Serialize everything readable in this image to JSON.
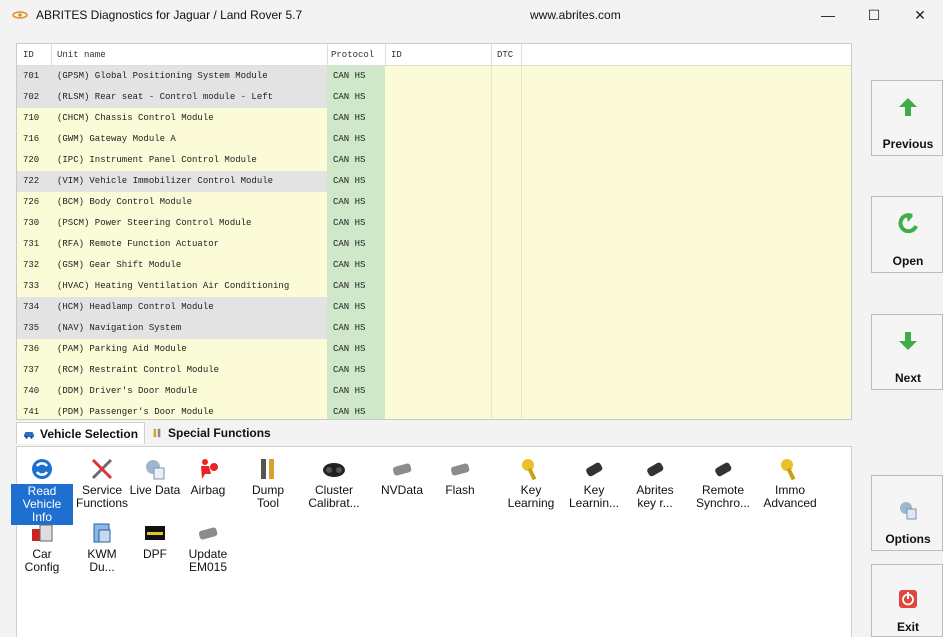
{
  "window": {
    "title": "ABRITES Diagnostics for Jaguar / Land Rover 5.7",
    "url": "www.abrites.com",
    "min_glyph": "—",
    "max_glyph": "☐",
    "close_glyph": "✕"
  },
  "table": {
    "headers": {
      "id": "ID",
      "unit_name": "Unit name",
      "protocol": "Protocol",
      "id2": "ID",
      "dtc": "DTC"
    },
    "rows": [
      {
        "id": "701",
        "name": "(GPSM) Global Positioning System Module",
        "protocol": "CAN HS",
        "shade": "grey"
      },
      {
        "id": "702",
        "name": "(RLSM) Rear seat  -  Control module  -  Left",
        "protocol": "CAN HS",
        "shade": "grey"
      },
      {
        "id": "710",
        "name": "(CHCM) Chassis Control Module",
        "protocol": "CAN HS",
        "shade": "yellow"
      },
      {
        "id": "716",
        "name": "(GWM) Gateway Module A",
        "protocol": "CAN HS",
        "shade": "yellow"
      },
      {
        "id": "720",
        "name": "(IPC) Instrument Panel Control Module",
        "protocol": "CAN HS",
        "shade": "yellow"
      },
      {
        "id": "722",
        "name": "(VIM) Vehicle Immobilizer Control Module",
        "protocol": "CAN HS",
        "shade": "grey"
      },
      {
        "id": "726",
        "name": "(BCM) Body Control Module",
        "protocol": "CAN HS",
        "shade": "yellow"
      },
      {
        "id": "730",
        "name": "(PSCM) Power Steering Control Module",
        "protocol": "CAN HS",
        "shade": "yellow"
      },
      {
        "id": "731",
        "name": "(RFA) Remote Function Actuator",
        "protocol": "CAN HS",
        "shade": "yellow"
      },
      {
        "id": "732",
        "name": "(GSM) Gear Shift Module",
        "protocol": "CAN HS",
        "shade": "yellow"
      },
      {
        "id": "733",
        "name": "(HVAC) Heating Ventilation Air Conditioning",
        "protocol": "CAN HS",
        "shade": "yellow"
      },
      {
        "id": "734",
        "name": "(HCM) Headlamp Control Module",
        "protocol": "CAN HS",
        "shade": "grey"
      },
      {
        "id": "735",
        "name": "(NAV) Navigation System",
        "protocol": "CAN HS",
        "shade": "grey"
      },
      {
        "id": "736",
        "name": "(PAM) Parking Aid Module",
        "protocol": "CAN HS",
        "shade": "yellow"
      },
      {
        "id": "737",
        "name": "(RCM) Restraint Control Module",
        "protocol": "CAN HS",
        "shade": "yellow"
      },
      {
        "id": "740",
        "name": "(DDM) Driver's Door Module",
        "protocol": "CAN HS",
        "shade": "yellow"
      },
      {
        "id": "741",
        "name": "(PDM) Passenger's Door Module",
        "protocol": "CAN HS",
        "shade": "yellow"
      }
    ]
  },
  "tabs": [
    {
      "label": "Vehicle Selection",
      "icon": "car-icon"
    },
    {
      "label": "Special Functions",
      "icon": "tools-icon"
    }
  ],
  "functions": [
    {
      "line1": "Read",
      "line2": "Vehicle",
      "line3": "Info",
      "icon": "read-info-icon",
      "selected": true
    },
    {
      "line1": "Service",
      "line2": "Functions",
      "line3": "",
      "icon": "service-tools-icon"
    },
    {
      "line1": "Live Data",
      "line2": "",
      "line3": "",
      "icon": "live-data-icon"
    },
    {
      "line1": "Airbag",
      "line2": "",
      "line3": "",
      "icon": "airbag-icon"
    },
    {
      "line1": "Dump",
      "line2": "Tool",
      "line3": "",
      "icon": "dump-tool-icon"
    },
    {
      "line1": "Cluster",
      "line2": "Calibrat...",
      "line3": "",
      "icon": "cluster-icon"
    },
    {
      "line1": "NVData",
      "line2": "",
      "line3": "",
      "icon": "nvdata-chip-icon"
    },
    {
      "line1": "Flash",
      "line2": "",
      "line3": "",
      "icon": "flash-chip-icon"
    },
    {
      "line1": "Key",
      "line2": "Learning",
      "line3": "",
      "icon": "key-learning-icon"
    },
    {
      "line1": "Key",
      "line2": "Learnin...",
      "line3": "",
      "icon": "key-learning-2-icon"
    },
    {
      "line1": "Abrites",
      "line2": "key r...",
      "line3": "",
      "icon": "abrites-key-icon"
    },
    {
      "line1": "Remote",
      "line2": "Synchro...",
      "line3": "",
      "icon": "remote-sync-icon"
    },
    {
      "line1": "Immo",
      "line2": "Advanced",
      "line3": "",
      "icon": "immo-advanced-icon"
    },
    {
      "line1": "Car",
      "line2": "Config",
      "line3": "",
      "icon": "car-config-icon"
    },
    {
      "line1": "KWM",
      "line2": "Du...",
      "line3": "",
      "icon": "kwm-dump-icon"
    },
    {
      "line1": "DPF",
      "line2": "",
      "line3": "",
      "icon": "dpf-icon"
    },
    {
      "line1": "Update",
      "line2": "EM015",
      "line3": "",
      "icon": "update-em015-icon"
    }
  ],
  "side_buttons": {
    "previous": "Previous",
    "open": "Open",
    "next": "Next",
    "options": "Options",
    "exit": "Exit"
  },
  "colors": {
    "accent_green": "#3fae49",
    "selected_blue": "#1f6fd1",
    "protocol_green": "#cfe8c9",
    "cell_yellow": "#fbfbd8",
    "exit_red": "#e0463b"
  }
}
